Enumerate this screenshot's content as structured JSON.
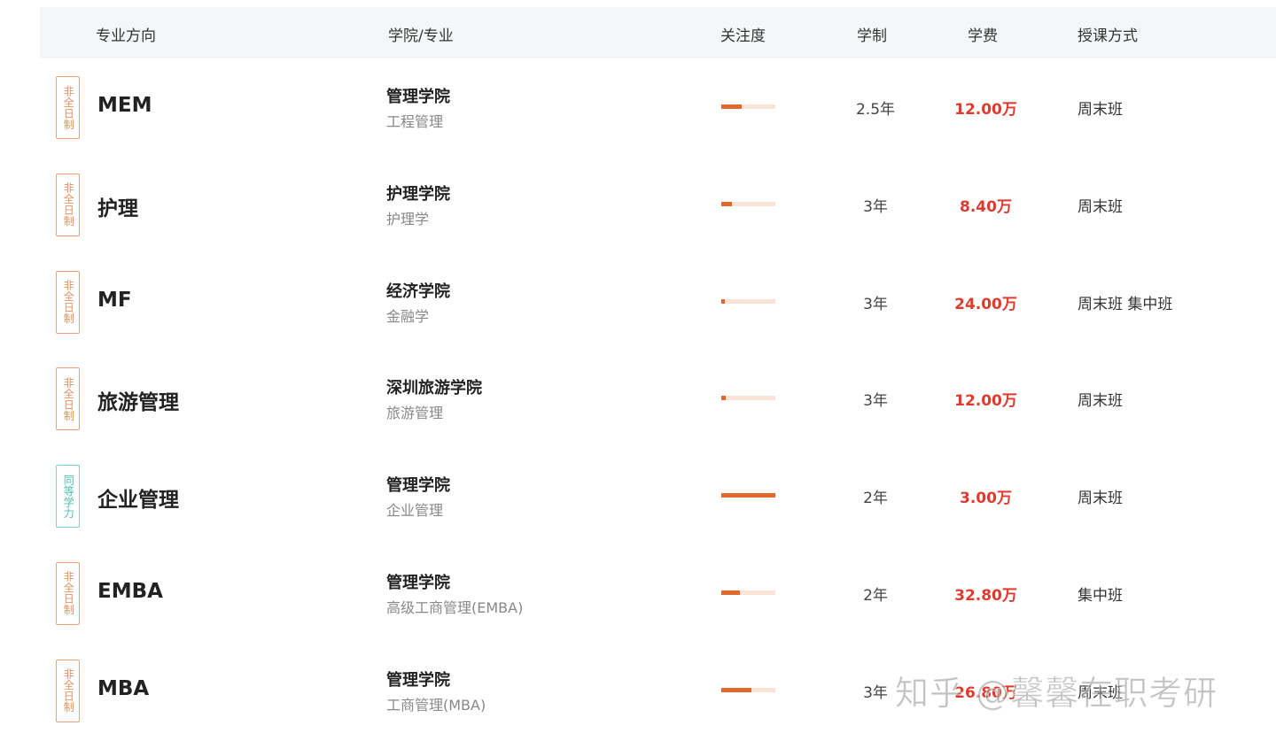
{
  "header": {
    "direction": "专业方向",
    "school": "学院/专业",
    "attention": "关注度",
    "duration": "学制",
    "fee": "学费",
    "mode": "授课方式"
  },
  "rows": [
    {
      "tag": "非全日制",
      "major": "MEM",
      "school": "管理学院",
      "program": "工程管理",
      "attention": 0.38,
      "duration": "2.5年",
      "fee": "12.00万",
      "mode": "周末班"
    },
    {
      "tag": "非全日制",
      "major": "护理",
      "school": "护理学院",
      "program": "护理学",
      "attention": 0.2,
      "duration": "3年",
      "fee": "8.40万",
      "mode": "周末班"
    },
    {
      "tag": "非全日制",
      "major": "MF",
      "school": "经济学院",
      "program": "金融学",
      "attention": 0.07,
      "duration": "3年",
      "fee": "24.00万",
      "mode": "周末班 集中班"
    },
    {
      "tag": "非全日制",
      "major": "旅游管理",
      "school": "深圳旅游学院",
      "program": "旅游管理",
      "attention": 0.08,
      "duration": "3年",
      "fee": "12.00万",
      "mode": "周末班"
    },
    {
      "tag": "同等学力",
      "major": "企业管理",
      "school": "管理学院",
      "program": "企业管理",
      "attention": 1.0,
      "duration": "2年",
      "fee": "3.00万",
      "mode": "周末班"
    },
    {
      "tag": "非全日制",
      "major": "EMBA",
      "school": "管理学院",
      "program": "高级工商管理(EMBA)",
      "attention": 0.34,
      "duration": "2年",
      "fee": "32.80万",
      "mode": "集中班"
    },
    {
      "tag": "非全日制",
      "major": "MBA",
      "school": "管理学院",
      "program": "工商管理(MBA)",
      "attention": 0.55,
      "duration": "3年",
      "fee": "26.80万",
      "mode": "周末班"
    }
  ],
  "watermark": "知乎 @馨馨在职考研",
  "colors": {
    "header_bg": "#f3f7f8",
    "fee": "#e03a2f",
    "bar_fill": "#e06a2d",
    "bar_track": "#fbe3d8",
    "tag_parttime": "#e39262",
    "tag_equivalent": "#4fbdb0"
  }
}
